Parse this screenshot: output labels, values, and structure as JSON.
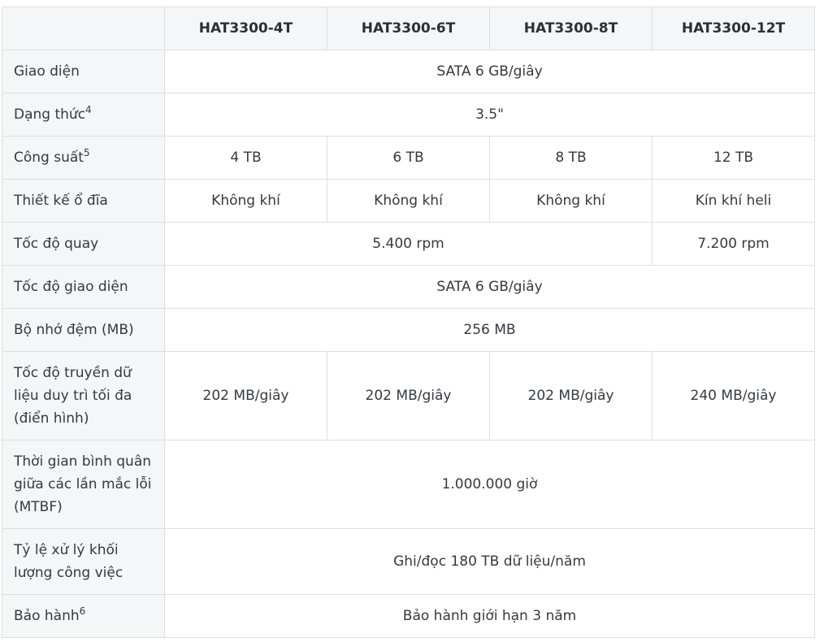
{
  "header": {
    "corner": "",
    "models": [
      "HAT3300-4T",
      "HAT3300-6T",
      "HAT3300-8T",
      "HAT3300-12T"
    ]
  },
  "rows": {
    "interface": {
      "label": "Giao diện",
      "value": "SATA 6 GB/giây"
    },
    "form_factor": {
      "label": "Dạng thức",
      "sup": "4",
      "value": "3.5\""
    },
    "capacity": {
      "label": "Công suất",
      "sup": "5",
      "values": [
        "4 TB",
        "6 TB",
        "8 TB",
        "12 TB"
      ]
    },
    "drive_design": {
      "label": "Thiết kế ổ đĩa",
      "values": [
        "Không khí",
        "Không khí",
        "Không khí",
        "Kín khí heli"
      ]
    },
    "rotation_speed": {
      "label": "Tốc độ quay",
      "value_span": "5.400 rpm",
      "value_last": "7.200 rpm"
    },
    "interface_speed": {
      "label": "Tốc độ giao diện",
      "value": "SATA 6 GB/giây"
    },
    "cache": {
      "label": "Bộ nhớ đệm (MB)",
      "value": "256 MB"
    },
    "transfer_rate": {
      "label_lines": [
        "Tốc độ truyền dữ",
        "liệu duy trì tối đa",
        "(điển hình)"
      ],
      "values": [
        "202 MB/giây",
        "202 MB/giây",
        "202 MB/giây",
        "240 MB/giây"
      ]
    },
    "mtbf": {
      "label_lines": [
        "Thời gian bình quân",
        "giữa các lần mắc lỗi",
        "(MTBF)"
      ],
      "value": "1.000.000 giờ"
    },
    "workload": {
      "label_lines": [
        "Tỷ lệ xử lý khối",
        "lượng công việc"
      ],
      "value": "Ghi/đọc 180 TB dữ liệu/năm"
    },
    "warranty": {
      "label": "Bảo hành",
      "sup": "6",
      "value": "Bảo hành giới hạn 3 năm"
    }
  }
}
